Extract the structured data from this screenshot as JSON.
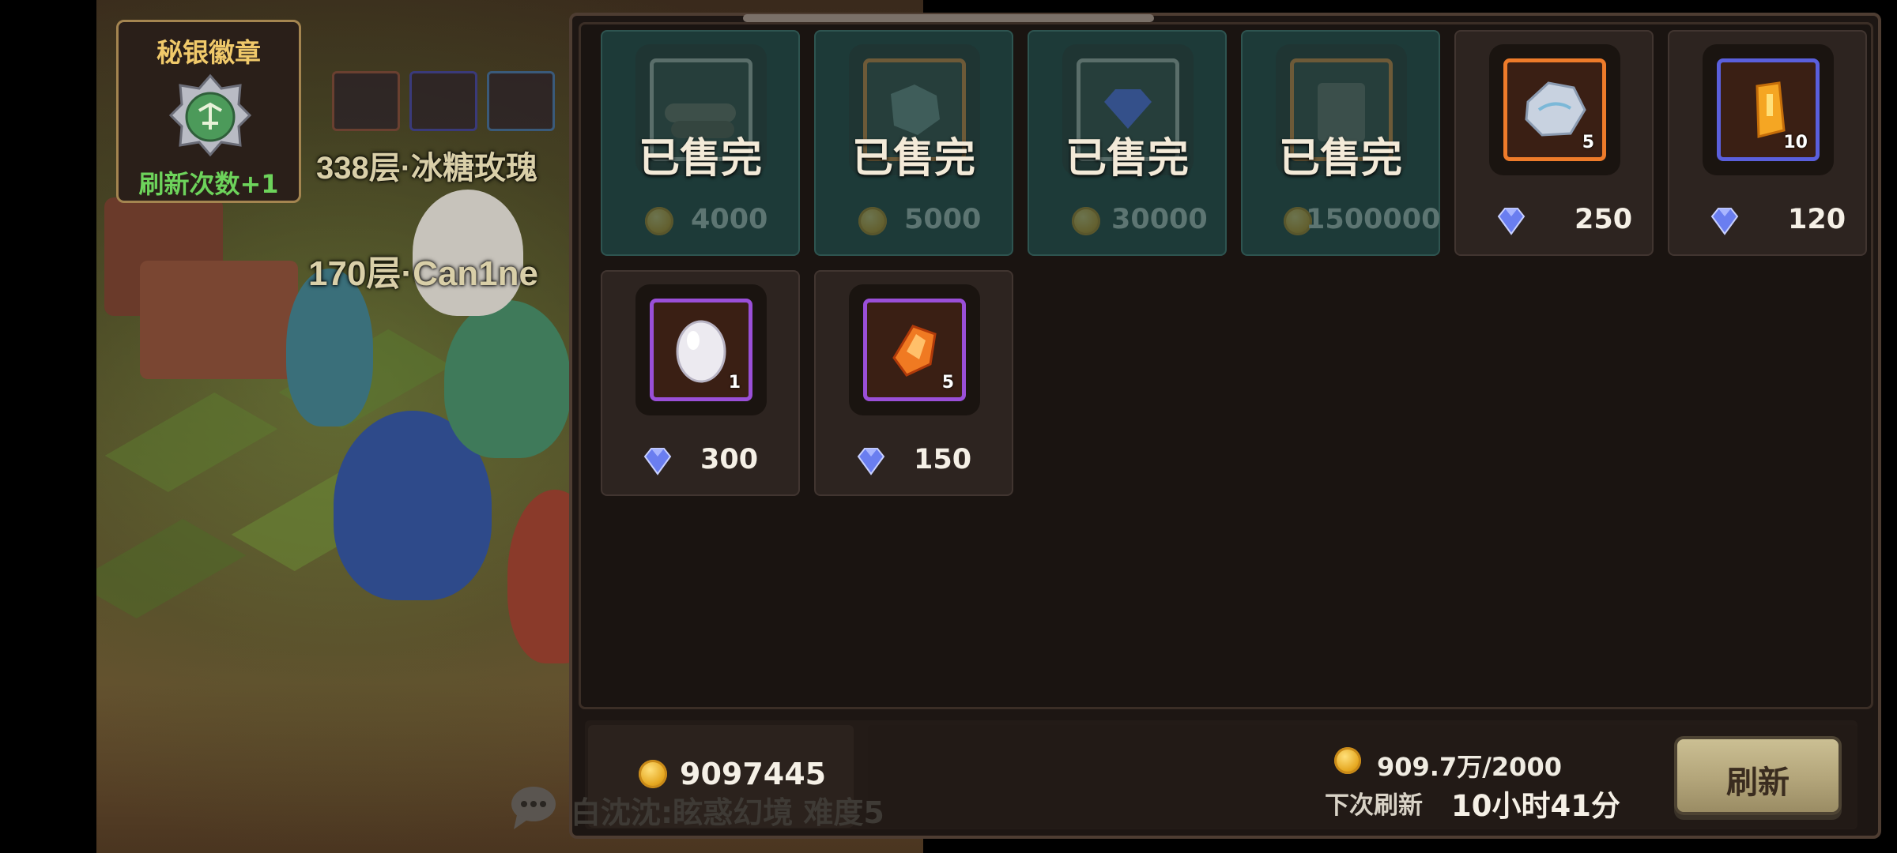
{
  "scene": {
    "floor_label_1": "338层·冰糖玫瑰",
    "floor_label_2": "170层·Can1ne",
    "chat_text": "白沈沈:眩惑幻境 难度5"
  },
  "badge": {
    "title": "秘银徽章",
    "subtitle": "刷新次数+1"
  },
  "shop": {
    "sold_label": "已售完",
    "items": [
      {
        "status": "sold",
        "item_icon": "wood-log-icon",
        "price": "4000",
        "currency": "gold-coin-icon"
      },
      {
        "status": "sold",
        "item_icon": "stone-ore-icon",
        "price": "5000",
        "currency": "gold-coin-icon"
      },
      {
        "status": "sold",
        "item_icon": "blue-gem-icon",
        "price": "30000",
        "currency": "gold-coin-icon"
      },
      {
        "status": "sold",
        "item_icon": "mystery-card-icon",
        "price": "1500000",
        "currency": "gold-coin-icon"
      },
      {
        "status": "available",
        "item_icon": "silver-ore-icon",
        "qty": "5",
        "price": "250",
        "currency": "diamond-icon",
        "frame": "orange"
      },
      {
        "status": "available",
        "item_icon": "gold-crystal-icon",
        "qty": "10",
        "price": "120",
        "currency": "diamond-icon",
        "frame": "blue"
      },
      {
        "status": "available",
        "item_icon": "white-egg-icon",
        "qty": "1",
        "price": "300",
        "currency": "diamond-icon",
        "frame": "purple"
      },
      {
        "status": "available",
        "item_icon": "fire-crystal-icon",
        "qty": "5",
        "price": "150",
        "currency": "diamond-icon",
        "frame": "purple"
      }
    ]
  },
  "footer": {
    "gold_amount": "9097445",
    "refresh_cost": "909.7万/2000",
    "next_refresh_label": "下次刷新",
    "next_refresh_time": "10小时41分",
    "refresh_button": "刷新"
  },
  "colors": {
    "sold_card_bg": "#1d3a38",
    "available_card_bg": "#2d2420",
    "badge_title": "#f0c96a",
    "badge_subtitle": "#6dd35b",
    "button_bg": "#b3a57a"
  }
}
